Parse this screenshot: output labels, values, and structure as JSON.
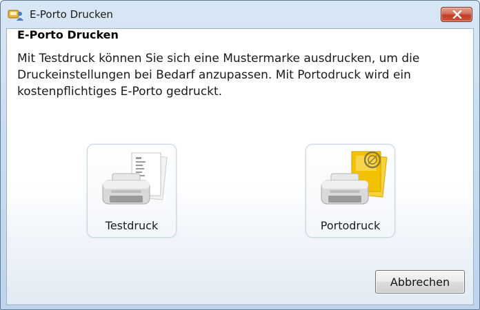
{
  "window": {
    "title": "E-Porto Drucken",
    "app_icon": "printer-person-icon",
    "close_icon": "close-icon"
  },
  "content": {
    "heading": "E-Porto Drucken",
    "description": "Mit Testdruck können Sie sich eine Mustermarke ausdrucken, um die Druckeinstellungen bei Bedarf anzupassen. Mit Portodruck wird ein kostenpflichtiges E-Porto gedruckt."
  },
  "options": [
    {
      "label": "Testdruck",
      "icon": "test-print-icon"
    },
    {
      "label": "Portodruck",
      "icon": "postage-print-icon"
    }
  ],
  "buttons": {
    "cancel_label": "Abbrechen"
  },
  "colors": {
    "close_button": "#c8472c",
    "window_frame": "#c8dcef",
    "stamp_yellow": "#f2c200"
  }
}
